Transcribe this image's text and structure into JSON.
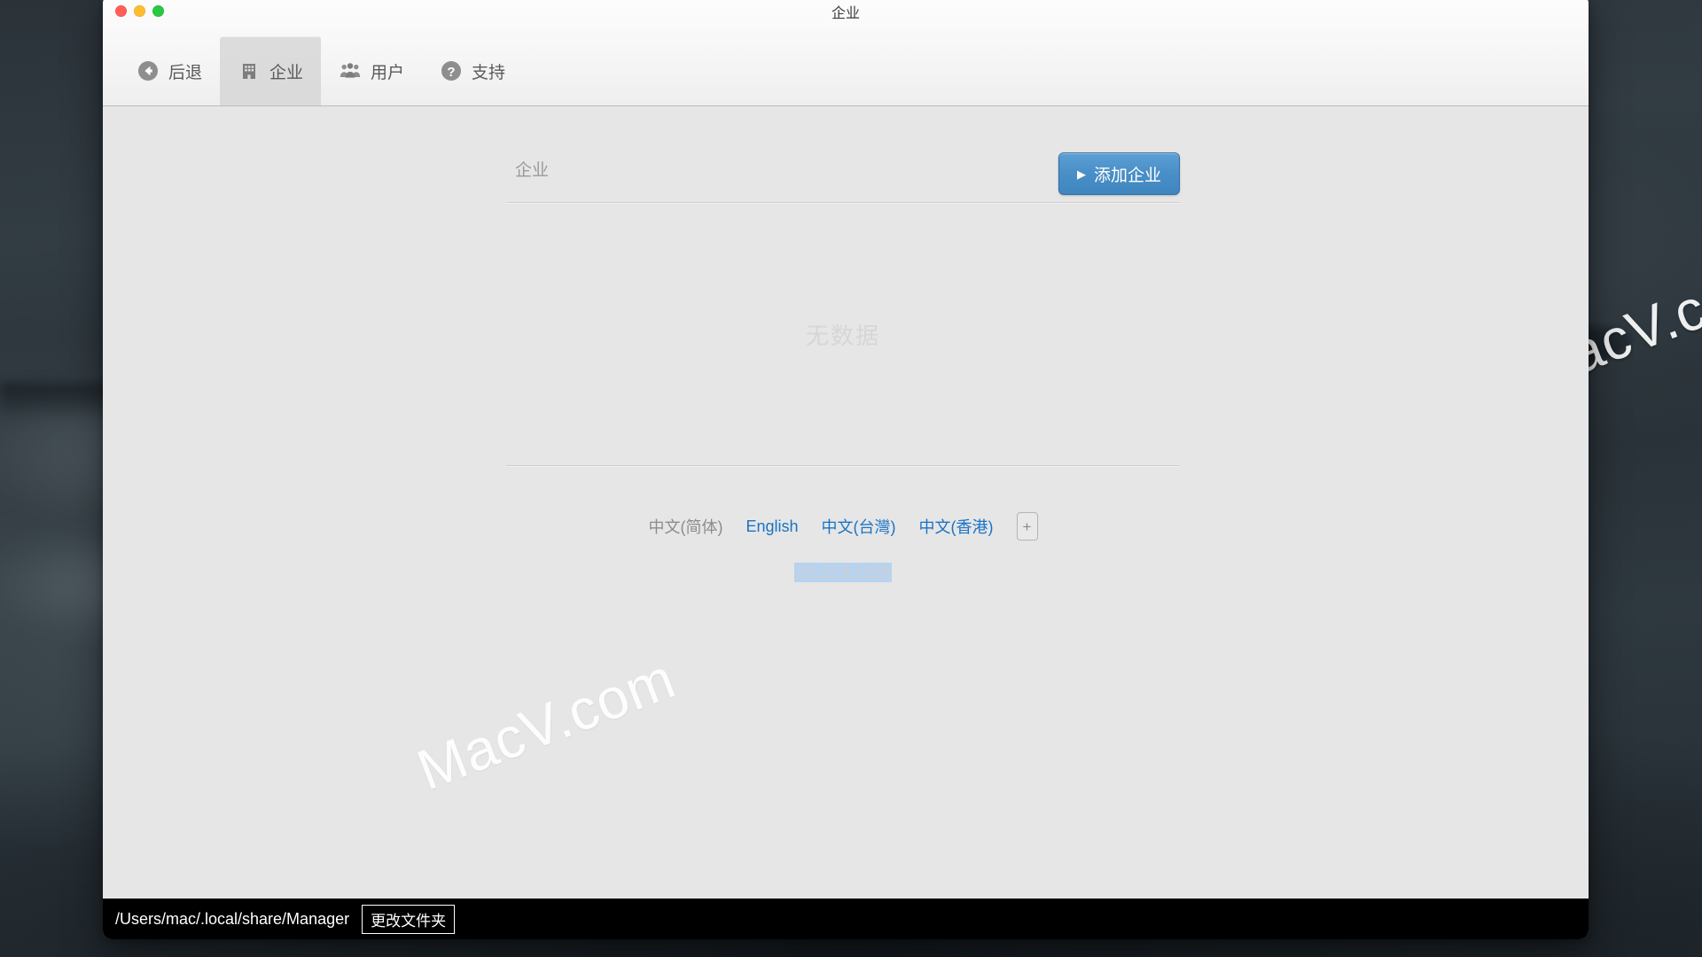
{
  "window": {
    "title": "企业",
    "traffic_lights": [
      "close",
      "minimize",
      "zoom"
    ]
  },
  "toolbar": {
    "items": [
      {
        "id": "back",
        "label": "后退",
        "icon": "back-circle-icon",
        "selected": false
      },
      {
        "id": "company",
        "label": "企业",
        "icon": "building-icon",
        "selected": true
      },
      {
        "id": "users",
        "label": "用户",
        "icon": "users-group-icon",
        "selected": false
      },
      {
        "id": "support",
        "label": "支持",
        "icon": "question-mark-icon",
        "selected": false
      }
    ]
  },
  "main": {
    "entity_input": {
      "placeholder": "企业",
      "value": ""
    },
    "add_button": {
      "label": "添加企业",
      "glyph": "▶",
      "color": "#4a90c8"
    },
    "empty_state": "无数据",
    "languages": [
      {
        "label": "中文(简体)",
        "current": true
      },
      {
        "label": "English",
        "current": false
      },
      {
        "label": "中文(台灣)",
        "current": false
      },
      {
        "label": "中文(香港)",
        "current": false
      }
    ],
    "language_add_label": "+",
    "version": "23.12.9.1219"
  },
  "statusbar": {
    "path": "/Users/mac/.local/share/Manager",
    "change_folder_label": "更改文件夹"
  },
  "watermarks": {
    "text": "MacV.com"
  }
}
